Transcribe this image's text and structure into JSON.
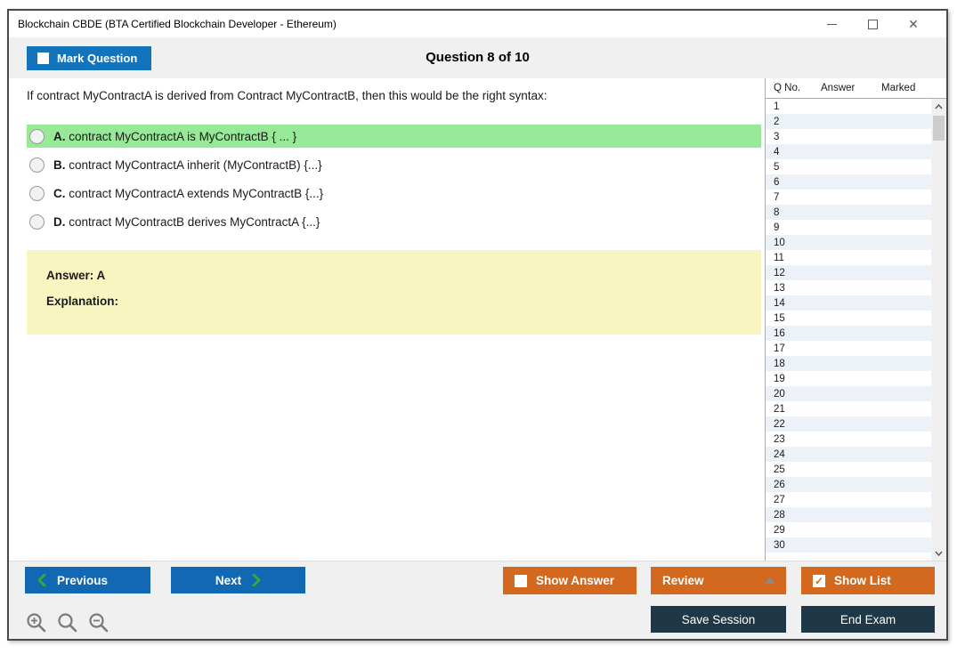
{
  "window": {
    "title": "Blockchain CBDE (BTA Certified Blockchain Developer - Ethereum)"
  },
  "header": {
    "mark_question_label": "Mark Question",
    "question_counter": "Question 8 of 10"
  },
  "question": {
    "text": "If contract MyContractA is derived from Contract MyContractB, then this would be the right syntax:",
    "options": [
      {
        "letter": "A.",
        "text": "contract MyContractA is MyContractB { ... }",
        "highlighted": true
      },
      {
        "letter": "B.",
        "text": "contract MyContractA inherit (MyContractB) {...}",
        "highlighted": false
      },
      {
        "letter": "C.",
        "text": "contract MyContractA extends MyContractB {...}",
        "highlighted": false
      },
      {
        "letter": "D.",
        "text": "contract MyContractB derives MyContractA {...}",
        "highlighted": false
      }
    ],
    "answer_label": "Answer: A",
    "explanation_label": "Explanation:"
  },
  "sidebar": {
    "columns": [
      "Q No.",
      "Answer",
      "Marked"
    ],
    "rows": [
      "1",
      "2",
      "3",
      "4",
      "5",
      "6",
      "7",
      "8",
      "9",
      "10",
      "11",
      "12",
      "13",
      "14",
      "15",
      "16",
      "17",
      "18",
      "19",
      "20",
      "21",
      "22",
      "23",
      "24",
      "25",
      "26",
      "27",
      "28",
      "29",
      "30"
    ]
  },
  "footer": {
    "previous_label": "Previous",
    "next_label": "Next",
    "show_answer_label": "Show Answer",
    "review_label": "Review",
    "show_list_label": "Show List",
    "save_session_label": "Save Session",
    "end_exam_label": "End Exam"
  },
  "colors": {
    "accent_blue": "#1374bc",
    "nav_blue": "#1268b2",
    "accent_orange": "#d2691e",
    "dark_navy": "#1f3847",
    "highlight_green": "#97e897",
    "answer_yellow": "#f9f5c0",
    "chevron_green": "#2ead3c"
  }
}
